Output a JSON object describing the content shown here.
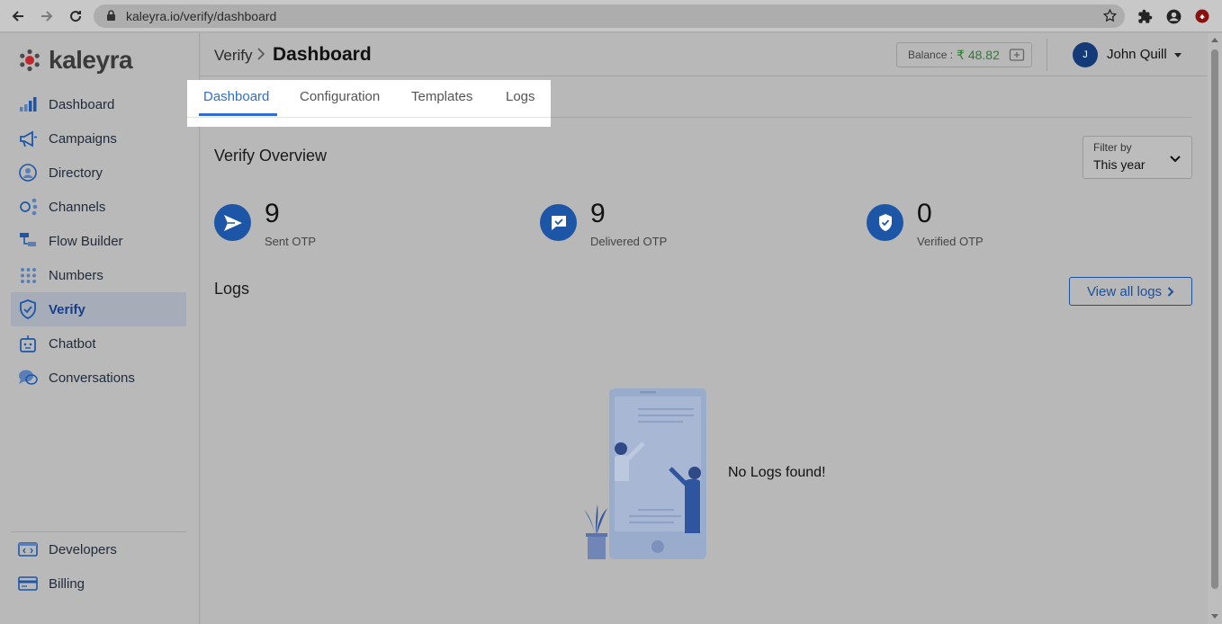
{
  "browser": {
    "url": "kaleyra.io/verify/dashboard"
  },
  "brand": {
    "name": "kaleyra"
  },
  "sidebar": {
    "items": [
      {
        "label": "Dashboard",
        "icon": "bar-chart-icon"
      },
      {
        "label": "Campaigns",
        "icon": "megaphone-icon"
      },
      {
        "label": "Directory",
        "icon": "contact-icon"
      },
      {
        "label": "Channels",
        "icon": "channels-icon"
      },
      {
        "label": "Flow Builder",
        "icon": "flow-icon"
      },
      {
        "label": "Numbers",
        "icon": "dialpad-icon"
      },
      {
        "label": "Verify",
        "icon": "shield-check-icon",
        "active": true
      },
      {
        "label": "Chatbot",
        "icon": "bot-icon"
      },
      {
        "label": "Conversations",
        "icon": "chat-bubbles-icon"
      }
    ],
    "bottom": [
      {
        "label": "Developers",
        "icon": "code-icon"
      },
      {
        "label": "Billing",
        "icon": "card-icon"
      }
    ]
  },
  "header": {
    "breadcrumb_parent": "Verify",
    "breadcrumb_current": "Dashboard",
    "balance_label": "Balance :",
    "balance_amount": "₹ 48.82",
    "user_initial": "J",
    "user_name": "John Quill"
  },
  "tabs": [
    {
      "label": "Dashboard",
      "active": true
    },
    {
      "label": "Configuration"
    },
    {
      "label": "Templates"
    },
    {
      "label": "Logs"
    }
  ],
  "overview": {
    "title": "Verify Overview",
    "filter_label": "Filter by",
    "filter_value": "This year",
    "stats": [
      {
        "value": "9",
        "label": "Sent OTP",
        "icon": "send-icon"
      },
      {
        "value": "9",
        "label": "Delivered OTP",
        "icon": "delivered-message-icon"
      },
      {
        "value": "0",
        "label": "Verified OTP",
        "icon": "verified-shield-icon"
      }
    ]
  },
  "logs": {
    "title": "Logs",
    "view_all": "View all logs",
    "empty_message": "No Logs found!"
  },
  "colors": {
    "accent": "#2f6fd1",
    "brand_dark": "#1d56a6",
    "balance_green": "#2e7d32"
  }
}
